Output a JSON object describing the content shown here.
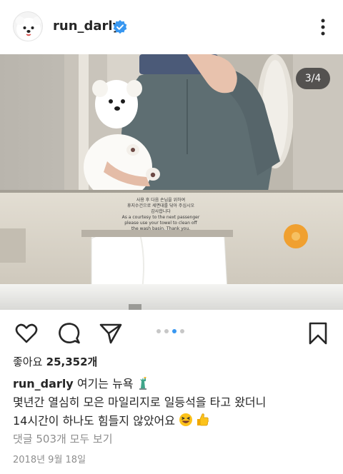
{
  "post": {
    "username": "run_darly",
    "verified": true,
    "photo_counter": "3/4",
    "photo_index": 3,
    "photo_total": 4,
    "sign_text": {
      "line1": "사용 후 다음 손님을 위하여",
      "line2": "휴지수건으로 세면대를 닦아 주십시오",
      "line3": "감사합니다",
      "line4": "As a courtesy to the next passenger",
      "line5": "please use your towel to clean off",
      "line6": "the wash basin. Thank you."
    },
    "likes_prefix": "좋아요",
    "likes_count": "25,352개",
    "caption_username": "run_darly",
    "caption_line1": "여기는 뉴욕",
    "caption_line2": "몇년간 열심히 모은 마일리지로 일등석을 타고 왔더니",
    "caption_line3": "14시간이 하나도 힘들지 않았어요",
    "comments_link": "댓글 503개 모두 보기",
    "date": "2018년 9월 18일"
  },
  "icons": {
    "verified": "verified-badge-icon",
    "more": "more-options-icon",
    "like": "heart-icon",
    "comment": "comment-icon",
    "share": "send-icon",
    "save": "bookmark-icon",
    "emoji_statue": "statue-of-liberty-emoji",
    "emoji_grin": "grinning-squinting-face-emoji",
    "emoji_thumbs": "thumbs-up-emoji"
  },
  "colors": {
    "verified_blue": "#3897f0",
    "text": "#262626",
    "muted": "#8e8e8e",
    "carousel_active": "#3897f0"
  }
}
